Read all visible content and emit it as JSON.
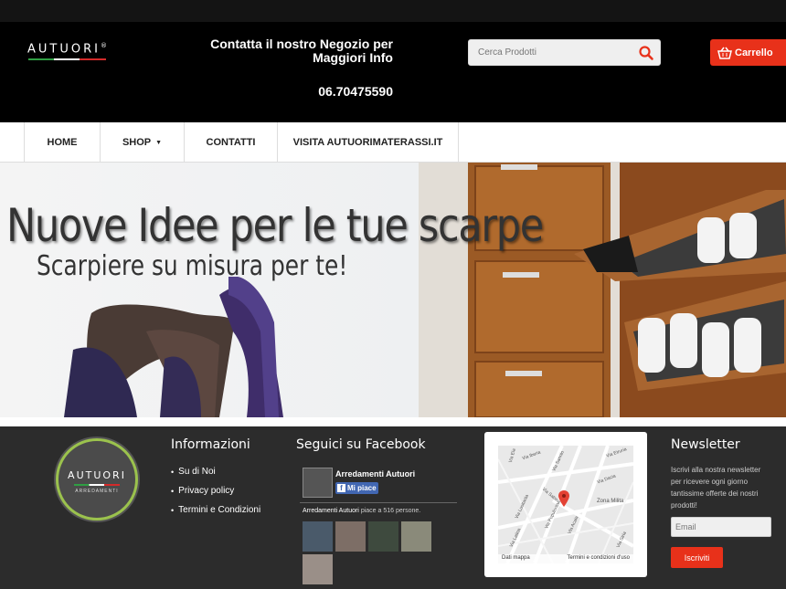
{
  "header": {
    "logo": "AUTUORI",
    "logo_mark": "®",
    "contact_line1": "Contatta il nostro Negozio per",
    "contact_line2": "Maggiori Info",
    "phone": "06.70475590",
    "search_placeholder": "Cerca Prodotti",
    "cart_label": "Carrello"
  },
  "nav": {
    "items": [
      {
        "label": "HOME"
      },
      {
        "label": "SHOP"
      },
      {
        "label": "CONTATTI"
      },
      {
        "label": "VISITA AUTUORIMATERASSI.IT"
      }
    ]
  },
  "hero": {
    "title": "Nuove Idee per le tue scarpe",
    "subtitle": "Scarpiere su misura per te!"
  },
  "footer": {
    "badge_title": "AUTUORI",
    "badge_sub": "ARREDAMENTI",
    "info_title": "Informazioni",
    "info_links": [
      "Su di Noi",
      "Privacy policy",
      "Termini e Condizioni"
    ],
    "fb_title": "Seguici su Facebook",
    "fb_page_name": "Arredamenti Autuori",
    "fb_like": "Mi piace",
    "fb_count_name": "Arredamenti Autuori",
    "fb_count_text": "piace a 516 persone.",
    "map_labels": [
      "Via Iberia",
      "Via Etruria",
      "Via Ela",
      "Via Sannio",
      "Via Dacia",
      "Via Lusitania",
      "Via Sabina",
      "Via Populonia",
      "Zona Milita",
      "Via Latina",
      "Via Acaia",
      "Via Siria"
    ],
    "map_data": "Dati mappa",
    "map_terms": "Termini e condizioni d'uso",
    "nl_title": "Newsletter",
    "nl_text": "Iscrivi alla nostra newsletter per ricevere ogni giorno tantissime offerte dei nostri prodotti!",
    "nl_placeholder": "Email",
    "nl_button": "Iscriviti"
  },
  "colors": {
    "accent": "#e8311a",
    "header_bg": "#000000",
    "footer_bg": "#2c2c2c",
    "facebook": "#4267b2"
  }
}
